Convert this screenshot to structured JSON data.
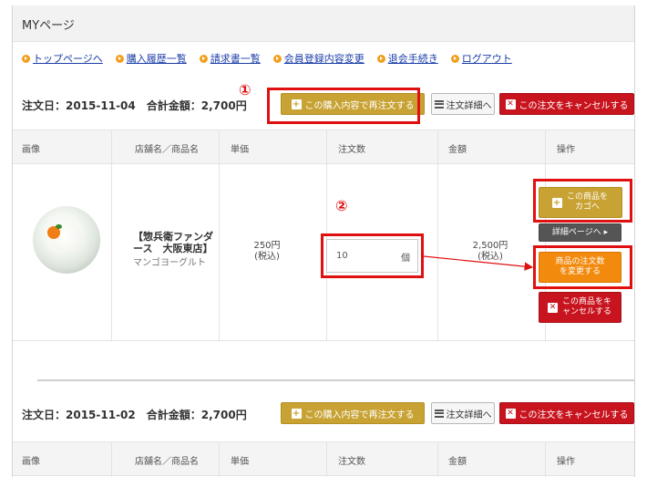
{
  "page_title": "MYページ",
  "nav_links": [
    "トップページへ",
    "購入履歴一覧",
    "請求書一覧",
    "会員登録内容変更",
    "退会手続き",
    "ログアウト"
  ],
  "orders": [
    {
      "header": "注文日：2015-11-04　合計金額：2,700円",
      "reorder_label": "この購入内容で再注文する",
      "detail_label": "注文詳細へ",
      "cancel_label": "この注文をキャンセルする"
    },
    {
      "header": "注文日：2015-11-02　合計金額：2,700円",
      "reorder_label": "この購入内容で再注文する",
      "detail_label": "注文詳細へ",
      "cancel_label": "この注文をキャンセルする"
    }
  ],
  "table_headers": [
    "画像",
    "店舗名／商品名",
    "単価",
    "注文数",
    "金額",
    "操作"
  ],
  "item": {
    "shop": "【惣兵衛ファンダース　大阪東店】",
    "product": "マンゴヨーグルト",
    "price": "250円",
    "tax": "(税込)",
    "qty": "10",
    "unit": "個",
    "amount": "2,500円",
    "amount_tax": "(税込)",
    "cart_label": "この商品をカゴへ",
    "detail_label": "詳細ページへ ▸",
    "change_label": "商品の注文数を変更する",
    "cancel_label": "この商品をキャンセルする"
  },
  "annotations": [
    "①",
    "②"
  ],
  "colors": {
    "gold": "#c8a233",
    "red": "#c8141e",
    "orange": "#f28a0e",
    "highlight": "#e01010",
    "link": "#1a3da8"
  }
}
